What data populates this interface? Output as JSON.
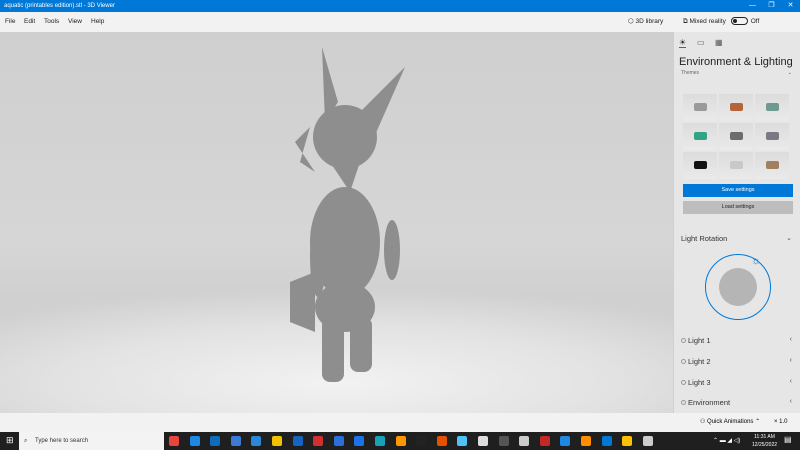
{
  "window": {
    "title": "aquatic (printables edition).stl - 3D Viewer",
    "controls": [
      "—",
      "❐",
      "✕"
    ]
  },
  "menu": [
    "File",
    "Edit",
    "Tools",
    "View",
    "Help"
  ],
  "toolbar": {
    "library": "3D library",
    "mixed_reality": "Mixed reality",
    "mixed_reality_state": "Off"
  },
  "panel": {
    "tabs": [
      "☀",
      "▭",
      "▦"
    ],
    "title": "Environment & Lighting",
    "themes_label": "Themes",
    "theme_colors": [
      "#9a9a9a",
      "#b5653a",
      "#6f9a92",
      "#2fa585",
      "#6c6c6c",
      "#7a7a85",
      "#111111",
      "#c9c9c9",
      "#a08060"
    ],
    "save": "Save settings",
    "load": "Load settings",
    "light_rotation": "Light Rotation",
    "lights": [
      "Light 1",
      "Light 2",
      "Light 3",
      "Environment"
    ]
  },
  "bottom": {
    "quick_animations": "Quick Animations",
    "speed": "× 1.0"
  },
  "taskbar": {
    "search_placeholder": "Type here to search",
    "time": "11:31 AM",
    "date": "12/25/2022",
    "app_colors": [
      "#e8453c",
      "#1e88e5",
      "#0f6cbd",
      "#3b7bd4",
      "#2b88d8",
      "#f2c200",
      "#1565c0",
      "#d32f2f",
      "#2a6fdb",
      "#1a73e8",
      "#17a2b8",
      "#ff9800",
      "#222",
      "#e65100",
      "#4fc3f7",
      "#ddd",
      "#555",
      "#ccc",
      "#c62828",
      "#1e88e5",
      "#ff8f00",
      "#0078d7",
      "#ffc107",
      "#ccc"
    ]
  },
  "accent": "#0078d7"
}
